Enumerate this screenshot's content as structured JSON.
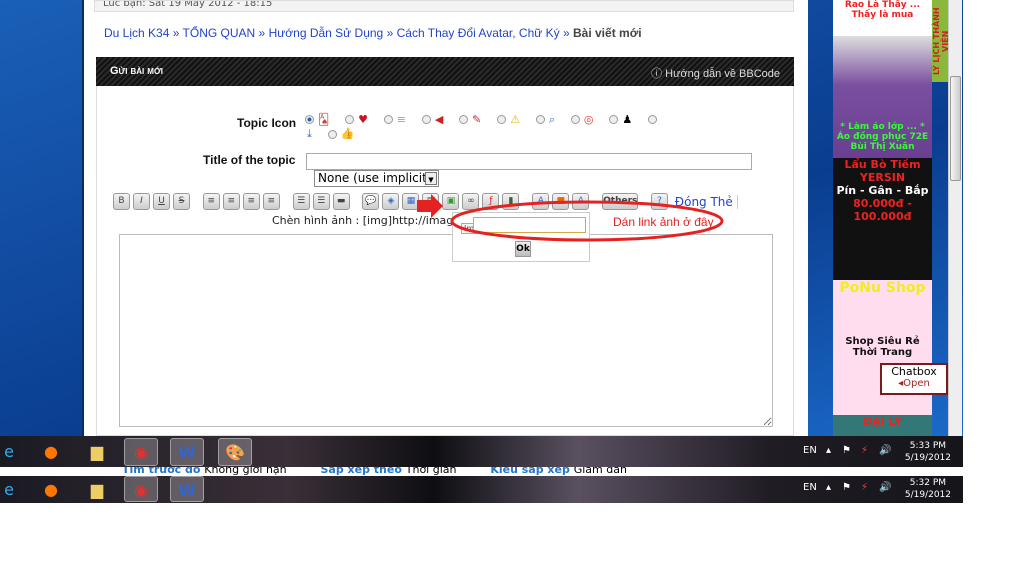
{
  "top_strip": "Lúc bạn: Sat 19 May 2012 - 18:15",
  "breadcrumb": [
    "Du Lịch K34",
    "TỔNG QUAN",
    "Hướng Dẫn Sử Dụng",
    "Cách Thay Đổi Avatar, Chữ Ký"
  ],
  "breadcrumb_current": "Bài viết mới",
  "breadcrumb_sep": "»",
  "header": {
    "title": "Gửi bài mới",
    "bbcode_help": "Hướng dẫn về BBCode"
  },
  "form": {
    "topic_icon_label": "Topic Icon",
    "topic_icons": [
      "cards-icon",
      "heart-icon",
      "chart-icon",
      "megaphone-icon",
      "pin-icon",
      "warning-icon",
      "search-icon",
      "lifebuoy-icon",
      "user-icon",
      "download-icon",
      "thumbs-up-icon"
    ],
    "selected_icon": 0,
    "title_label": "Title of the topic",
    "title_value": "",
    "select_value": "None (use implicit)",
    "toolbar": {
      "bold": "B",
      "italic": "I",
      "underline": "U",
      "strike": "S",
      "others": "Others",
      "close_tags": "Đóng Thẻ"
    },
    "hint": "Chèn hình ảnh : [img]http://image_u",
    "popup": {
      "tooltip": "Image",
      "ok": "Ok"
    },
    "annotation": "Dán link ảnh ở đây",
    "annotation_color": "#e52222"
  },
  "sort_strip": {
    "l1": "Tìm trước đó",
    "v1": "Không giới hạn",
    "l2": "Sắp xếp theo",
    "v2": "Thời gian",
    "l3": "Kiểu sắp xếp",
    "v3": "Giảm dần"
  },
  "ads": {
    "a1": "Rao Là Thấy ... Thấy là mua",
    "side": "LÝ LỊCH THÀNH VIÊN",
    "a2": "* Làm áo lớp ... * Áo đồng phục 72E Bùi Thị Xuân",
    "a3": "Lẩu Bò Tiềm YERSIN",
    "a3b": "Pín - Gân - Bắp",
    "a3c": "80.000đ - 100.000đ",
    "a4": "PoNu Shop",
    "a4b": "Shop Siêu Rẻ Thời Trang",
    "a5": "ĐẠI LÝ"
  },
  "chatbox": {
    "title": "Chatbox",
    "open": "Open"
  },
  "taskbar1": {
    "lang": "EN",
    "time": "5:33 PM",
    "date": "5/19/2012"
  },
  "taskbar2": {
    "lang": "EN",
    "time": "5:32 PM",
    "date": "5/19/2012"
  }
}
